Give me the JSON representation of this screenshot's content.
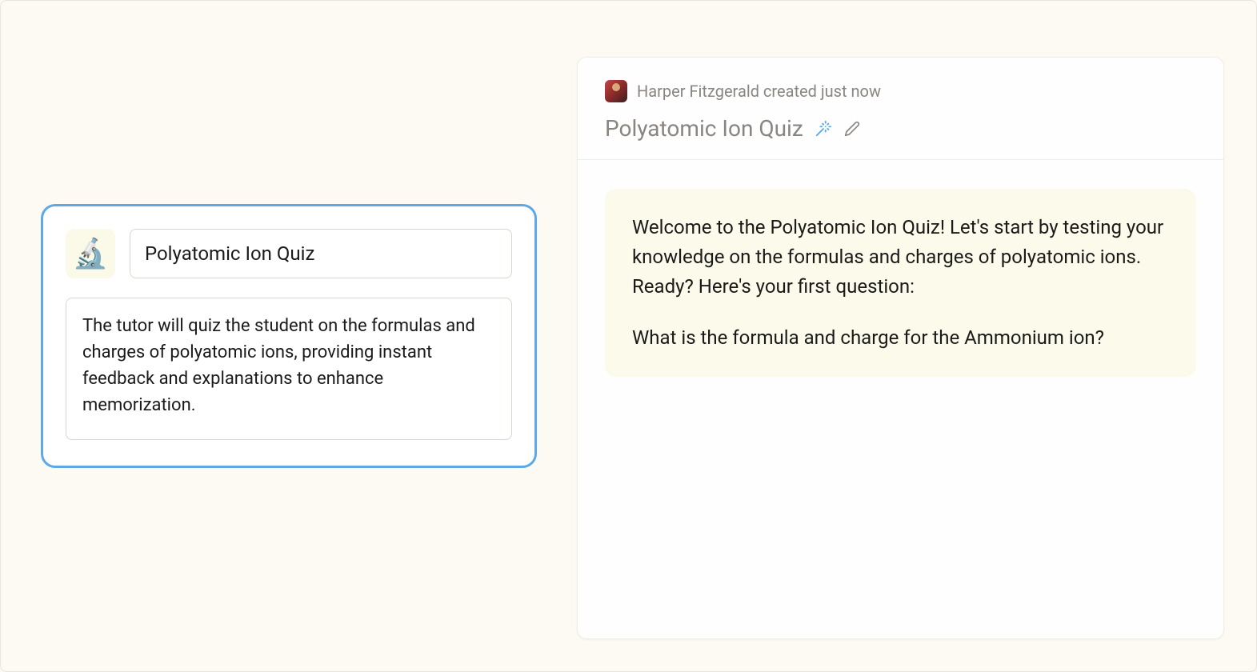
{
  "config": {
    "icon_emoji": "🔬",
    "title": "Polyatomic Ion Quiz",
    "description": "The tutor will quiz the student on the formulas and charges of polyatomic ions, providing instant feedback and explanations to enhance memorization."
  },
  "preview": {
    "creator_text": "Harper Fitzgerald created just now",
    "title": "Polyatomic Ion Quiz",
    "message_para1": "Welcome to the Polyatomic Ion Quiz! Let's start by testing your knowledge on the formulas and charges of polyatomic ions. Ready? Here's your first question:",
    "message_para2": "What is the formula and charge for the Ammonium ion?"
  },
  "colors": {
    "accent": "#5ea8e8",
    "bg_cream": "#fcfaf2",
    "bubble_bg": "#fcfaea",
    "muted_text": "#8a8580"
  }
}
